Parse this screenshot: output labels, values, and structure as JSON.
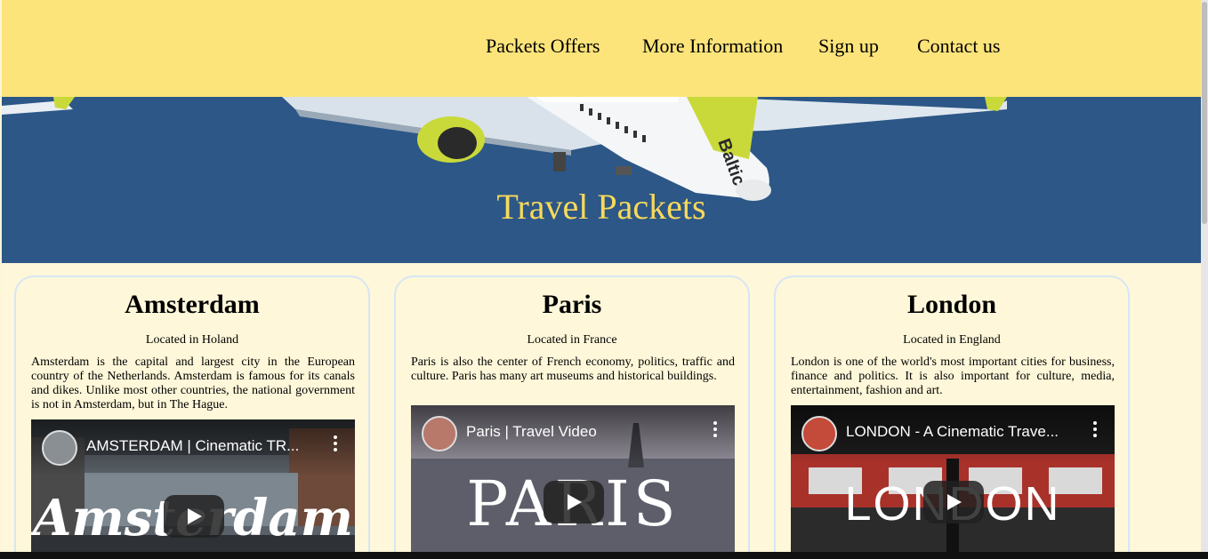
{
  "nav": {
    "items": [
      {
        "label": "Packets Offers"
      },
      {
        "label": "More Information"
      },
      {
        "label": "Sign up"
      },
      {
        "label": "Contact us"
      }
    ]
  },
  "hero": {
    "title": "Travel Packets",
    "plane_livery": "Baltic"
  },
  "cards": [
    {
      "city": "Amsterdam",
      "location": "Located in Holand",
      "description": "Amsterdam is the capital and largest city in the European country of the Netherlands. Amsterdam is famous for its canals and dikes. Unlike most other countries, the national government is not in Amsterdam, but in The Hague.",
      "video_title": "AMSTERDAM | Cinematic TR...",
      "video_overlay": "Amsterdam"
    },
    {
      "city": "Paris",
      "location": "Located in France",
      "description": "Paris is also the center of French economy, politics, traffic and culture. Paris has many art museums and historical buildings.",
      "video_title": "Paris | Travel Video",
      "video_overlay": "PARIS"
    },
    {
      "city": "London",
      "location": "Located in England",
      "description": "London is one of the world's most important cities for business, finance and politics. It is also important for culture, media, entertainment, fashion and art.",
      "video_title": "LONDON - A Cinematic Trave...",
      "video_overlay": "LONDON"
    }
  ],
  "colors": {
    "nav_bg": "#fde47a",
    "hero_bg": "#2b5686",
    "hero_title": "#f8d95a",
    "page_bg": "#fef7d9",
    "card_border": "#d6e6f5"
  }
}
